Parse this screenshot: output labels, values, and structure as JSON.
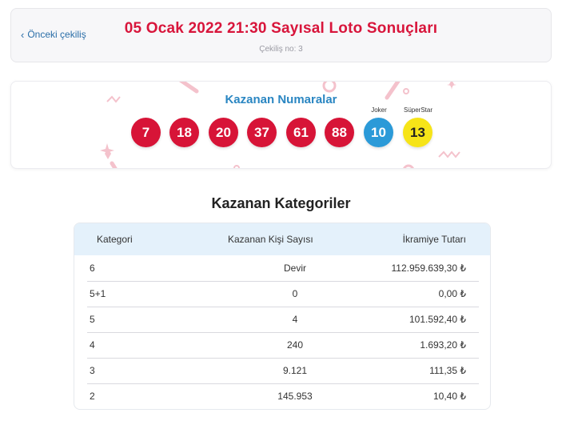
{
  "header": {
    "back_label": "Önceki çekiliş",
    "title": "05 Ocak 2022 21:30 Sayısal Loto Sonuçları",
    "draw_no": "Çekiliş no: 3"
  },
  "numbers": {
    "title": "Kazanan Numaralar",
    "balls": [
      "7",
      "18",
      "20",
      "37",
      "61",
      "88"
    ],
    "joker_label": "Joker",
    "joker": "10",
    "superstar_label": "SüperStar",
    "superstar": "13",
    "colors": {
      "main": "#d71437",
      "joker": "#2b9ad8",
      "superstar": "#f6e418"
    }
  },
  "categories": {
    "title": "Kazanan Kategoriler",
    "headers": [
      "Kategori",
      "Kazanan Kişi Sayısı",
      "İkramiye Tutarı"
    ],
    "rows": [
      [
        "6",
        "Devir",
        "112.959.639,30 ₺"
      ],
      [
        "5+1",
        "0",
        "0,00 ₺"
      ],
      [
        "5",
        "4",
        "101.592,40 ₺"
      ],
      [
        "4",
        "240",
        "1.693,20 ₺"
      ],
      [
        "3",
        "9.121",
        "111,35 ₺"
      ],
      [
        "2",
        "145.953",
        "10,40 ₺"
      ]
    ]
  }
}
